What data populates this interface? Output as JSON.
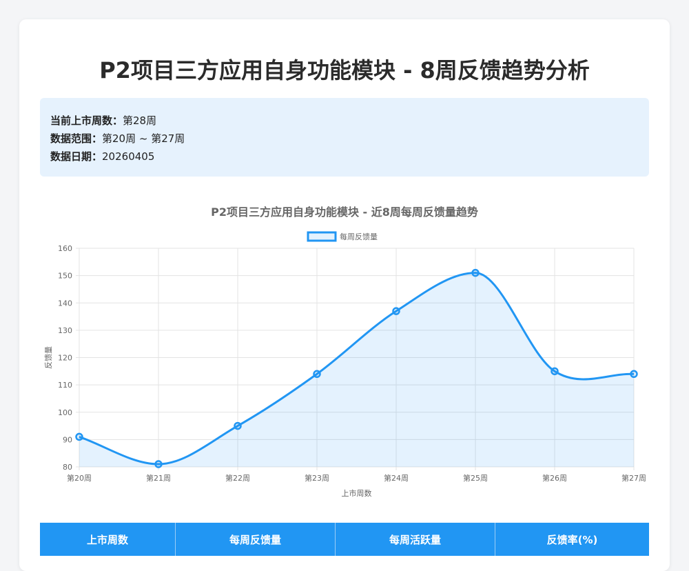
{
  "page_title": "P2项目三方应用自身功能模块 - 8周反馈趋势分析",
  "info": [
    {
      "label": "当前上市周数：",
      "value": "第28周"
    },
    {
      "label": "数据范围：",
      "value": "第20周 ~ 第27周"
    },
    {
      "label": "数据日期：",
      "value": "20260405"
    }
  ],
  "chart_data": {
    "type": "line",
    "title": "P2项目三方应用自身功能模块 - 近8周每周反馈量趋势",
    "xlabel": "上市周数",
    "ylabel": "反馈量",
    "categories": [
      "第20周",
      "第21周",
      "第22周",
      "第23周",
      "第24周",
      "第25周",
      "第26周",
      "第27周"
    ],
    "series": [
      {
        "name": "每周反馈量",
        "values": [
          91,
          81,
          95,
          114,
          137,
          151,
          115,
          114
        ]
      }
    ],
    "ylim": [
      80,
      160
    ],
    "yticks": [
      80,
      90,
      100,
      110,
      120,
      130,
      140,
      150,
      160
    ],
    "grid": true,
    "legend": "top-center",
    "smooth": true,
    "filled": true,
    "colors": {
      "line": "#2196f3",
      "fill": "rgba(33,150,243,0.12)",
      "grid": "#e3e3e3"
    }
  },
  "table": {
    "headers": [
      "上市周数",
      "每周反馈量",
      "每周活跃量",
      "反馈率(%)"
    ]
  }
}
